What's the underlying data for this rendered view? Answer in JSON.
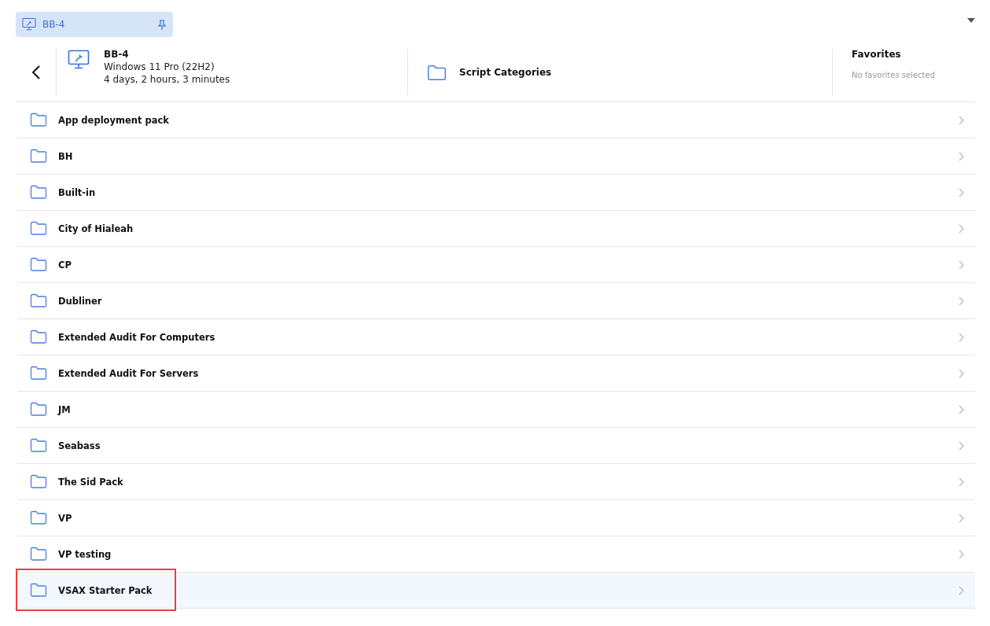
{
  "tab": {
    "label": "BB-4",
    "pinned": true
  },
  "device": {
    "name": "BB-4",
    "os": "Windows 11 Pro (22H2)",
    "uptime": "4 days, 2 hours, 3 minutes"
  },
  "section": {
    "title": "Script Categories"
  },
  "favorites": {
    "title": "Favorites",
    "empty_text": "No favorites selected"
  },
  "categories": [
    {
      "label": "App deployment pack",
      "selected": false,
      "outlined": false
    },
    {
      "label": "BH",
      "selected": false,
      "outlined": false
    },
    {
      "label": "Built-in",
      "selected": false,
      "outlined": false
    },
    {
      "label": "City of Hialeah",
      "selected": false,
      "outlined": false
    },
    {
      "label": "CP",
      "selected": false,
      "outlined": false
    },
    {
      "label": "Dubliner",
      "selected": false,
      "outlined": false
    },
    {
      "label": "Extended Audit For Computers",
      "selected": false,
      "outlined": false
    },
    {
      "label": "Extended Audit For Servers",
      "selected": false,
      "outlined": false
    },
    {
      "label": "JM",
      "selected": false,
      "outlined": false
    },
    {
      "label": "Seabass",
      "selected": false,
      "outlined": false
    },
    {
      "label": "The Sid Pack",
      "selected": false,
      "outlined": false
    },
    {
      "label": "VP",
      "selected": false,
      "outlined": false
    },
    {
      "label": "VP testing",
      "selected": false,
      "outlined": false
    },
    {
      "label": "VSAX Starter Pack",
      "selected": true,
      "outlined": true
    }
  ]
}
